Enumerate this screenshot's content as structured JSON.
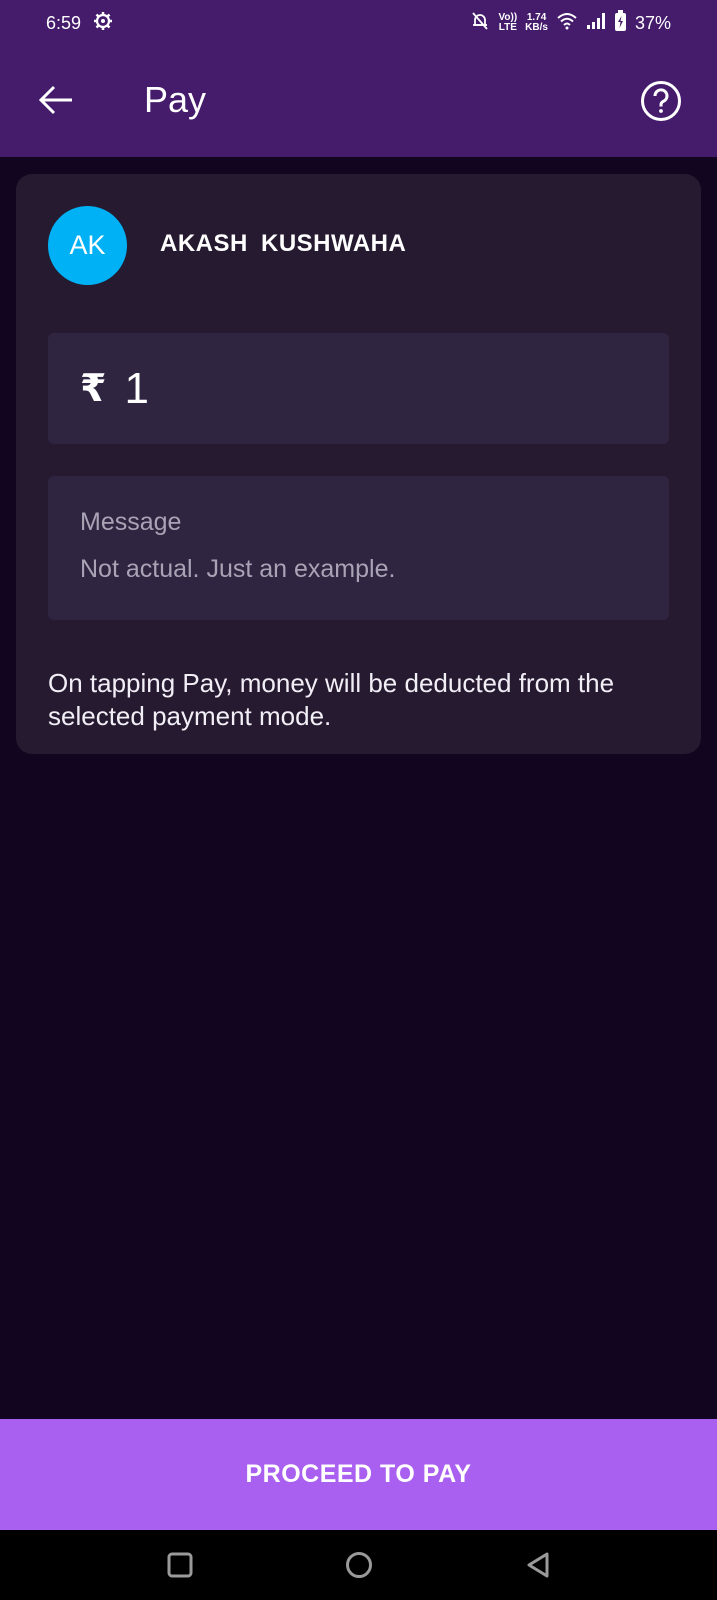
{
  "status_bar": {
    "time": "6:59",
    "network_top": "1.74",
    "network_bottom": "KB/s",
    "volte_top": "Vo))",
    "volte_bottom": "LTE",
    "battery": "37%"
  },
  "app_bar": {
    "title": "Pay",
    "back_icon": "arrow-left-icon",
    "help_icon": "help-circle-icon"
  },
  "payee": {
    "initials": "AK",
    "name": "AKASH  KUSHWAHA",
    "avatar_color": "#00b2f5"
  },
  "amount": {
    "currency_symbol": "₹",
    "value": "1"
  },
  "message": {
    "label": "Message",
    "text": "Not actual. Just an example."
  },
  "info_text": "On tapping Pay, money will be deducted from the selected payment mode.",
  "proceed_button": {
    "label": "PROCEED TO PAY",
    "color": "#a95ff0"
  },
  "nav_bar": {
    "icons": [
      "recents-icon",
      "home-icon",
      "back-icon"
    ]
  },
  "colors": {
    "header_bg": "#451b6b",
    "page_bg": "#12051f",
    "card_bg": "#251a30"
  }
}
